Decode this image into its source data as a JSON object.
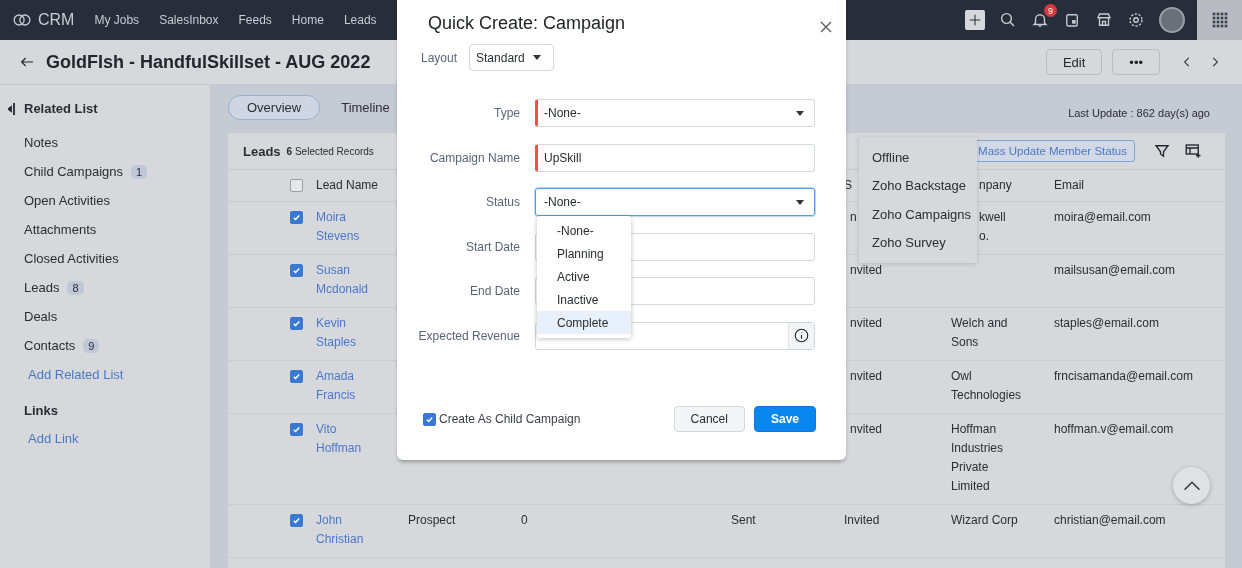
{
  "nav": {
    "logo": "CRM",
    "items": [
      "My Jobs",
      "SalesInbox",
      "Feeds",
      "Home",
      "Leads"
    ],
    "notification_count": "9"
  },
  "header": {
    "title": "GoldFIsh - HandfulSkillset - AUG 2022",
    "buttons": [
      "Edit",
      "•••"
    ]
  },
  "sidebar": {
    "heading": "Related List",
    "items": [
      {
        "label": "Notes"
      },
      {
        "label": "Child Campaigns",
        "count": "1"
      },
      {
        "label": "Open Activities"
      },
      {
        "label": "Attachments"
      },
      {
        "label": "Closed Activities"
      },
      {
        "label": "Leads",
        "count": "8"
      },
      {
        "label": "Deals"
      },
      {
        "label": "Contacts",
        "count": "9"
      }
    ],
    "add_link": "Add Related List",
    "links_heading": "Links",
    "links_add": "Add Link"
  },
  "tabs": [
    {
      "label": "Overview",
      "selected": true
    },
    {
      "label": "Timeline",
      "selected": false
    }
  ],
  "last_update": "Last Update : 862 day(s) ago",
  "table": {
    "title": "Leads",
    "selection_count": "6",
    "selection_label": "Selected Records",
    "mass_update": "Mass Update Member Status",
    "header": {
      "checked": false,
      "lead_name": "Lead Name",
      "column_6": "S",
      "column_7": "npany",
      "email": "Email"
    },
    "rows": [
      {
        "checked": true,
        "lead_name": "Moira Stevens",
        "column_6": "n",
        "column_7": "kwell\no.",
        "email": "moira@email.com"
      },
      {
        "checked": true,
        "lead_name": "Susan Mcdonald",
        "column_6": "nvited",
        "email": "mailsusan@email.com"
      },
      {
        "checked": true,
        "lead_name": "Kevin Staples",
        "column_6": "nvited",
        "column_7": "Welch and Sons",
        "email": "staples@email.com"
      },
      {
        "checked": true,
        "lead_name": "Amada Francis",
        "column_6": "nvited",
        "column_7": "Owl Technologies",
        "email": "frncisamanda@email.com"
      },
      {
        "checked": true,
        "lead_name": "Vito Hoffman",
        "column_6": "nvited",
        "column_7": "Hoffman Industries Private Limited",
        "email": "hoffman.v@email.com"
      },
      {
        "checked": true,
        "lead_name": "John Christian",
        "column_3": "Prospect",
        "column_4": "0",
        "column_5": "Sent",
        "column_6": "Invited",
        "column_7": "Wizard Corp",
        "email": "christian@email.com"
      }
    ]
  },
  "source_menu": [
    "Offline",
    "Zoho Backstage",
    "Zoho Campaigns",
    "Zoho Survey"
  ],
  "modal": {
    "title": "Quick Create: Campaign",
    "layout_label": "Layout",
    "layout_value": "Standard",
    "fields": [
      {
        "label": "Type",
        "kind": "select",
        "value": "-None-",
        "required": true,
        "focused": false
      },
      {
        "label": "Campaign Name",
        "kind": "text",
        "value": "UpSkill",
        "required": true,
        "focused": false
      },
      {
        "label": "Status",
        "kind": "select",
        "value": "-None-",
        "required": false,
        "focused": true
      },
      {
        "label": "Start Date",
        "kind": "text",
        "required": false,
        "focused": false
      },
      {
        "label": "End Date",
        "kind": "text",
        "required": false,
        "focused": false
      },
      {
        "label": "Expected Revenue",
        "kind": "info",
        "required": false,
        "focused": false
      }
    ],
    "status_options": [
      {
        "label": "-None-",
        "highlighted": false
      },
      {
        "label": "Planning",
        "highlighted": false
      },
      {
        "label": "Active",
        "highlighted": false
      },
      {
        "label": "Inactive",
        "highlighted": false
      },
      {
        "label": "Complete",
        "highlighted": true
      }
    ],
    "child_checkbox": {
      "label": "Create As Child Campaign",
      "checked": true
    },
    "buttons": [
      {
        "label": "Cancel",
        "kind": "secondary"
      },
      {
        "label": "Save",
        "kind": "primary"
      }
    ]
  }
}
